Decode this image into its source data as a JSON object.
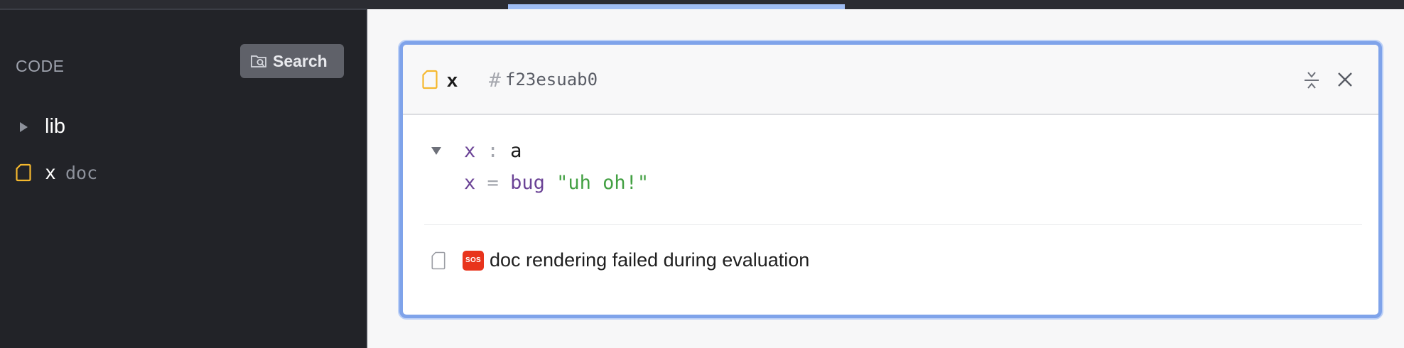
{
  "sidebar": {
    "title": "CODE",
    "search_label": "Search",
    "items": [
      {
        "label": "lib",
        "kind": "namespace"
      },
      {
        "label": "x",
        "tag": "doc",
        "kind": "doc"
      }
    ]
  },
  "card": {
    "name": "x",
    "hash_symbol": "#",
    "hash": "f23esuab0",
    "code": {
      "line1": {
        "name": "x",
        "sep": ":",
        "type": "a"
      },
      "line2": {
        "name": "x",
        "op": "=",
        "fn": "bug",
        "str": "\"uh oh!\""
      }
    },
    "doc": {
      "badge": "SOS",
      "message": "doc rendering failed during evaluation"
    }
  },
  "colors": {
    "accent": "#7fa3ea",
    "sidebar_bg": "#222328",
    "doc_icon": "#f5b82e",
    "string": "#43a043",
    "identifier": "#6b4396",
    "error_badge": "#e8341c"
  }
}
